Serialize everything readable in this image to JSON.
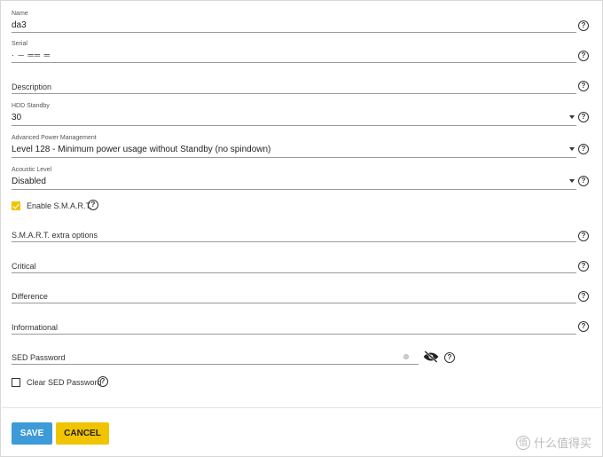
{
  "fields": {
    "name": {
      "label": "Name",
      "value": "da3"
    },
    "serial": {
      "label": "Serial",
      "value": "· ─ ══ ═"
    },
    "description": {
      "placeholder": "Description"
    },
    "hdd_standby": {
      "label": "HDD Standby",
      "value": "30"
    },
    "apm": {
      "label": "Advanced Power Management",
      "value": "Level 128 - Minimum power usage without Standby (no spindown)"
    },
    "acoustic": {
      "label": "Acoustic Level",
      "value": "Disabled"
    },
    "enable_smart": {
      "label": "Enable S.M.A.R.T.",
      "checked": true
    },
    "smart_options": {
      "placeholder": "S.M.A.R.T. extra options"
    },
    "critical": {
      "placeholder": "Critical"
    },
    "difference": {
      "placeholder": "Difference"
    },
    "informational": {
      "placeholder": "Informational"
    },
    "sed_password": {
      "placeholder": "SED Password"
    },
    "clear_sed": {
      "label": "Clear SED Password",
      "checked": false
    }
  },
  "help_glyph": "?",
  "buttons": {
    "save": "SAVE",
    "cancel": "CANCEL"
  },
  "watermark": {
    "logo_text": "值",
    "text": "什么值得买"
  },
  "colors": {
    "save": "#3d9bd8",
    "cancel": "#f0c400",
    "checkbox": "#f0c400"
  },
  "icons": {
    "help": "help-circle-icon",
    "dropdown": "caret-down-icon",
    "visibility": "eye-off-icon",
    "check": "check-icon"
  }
}
